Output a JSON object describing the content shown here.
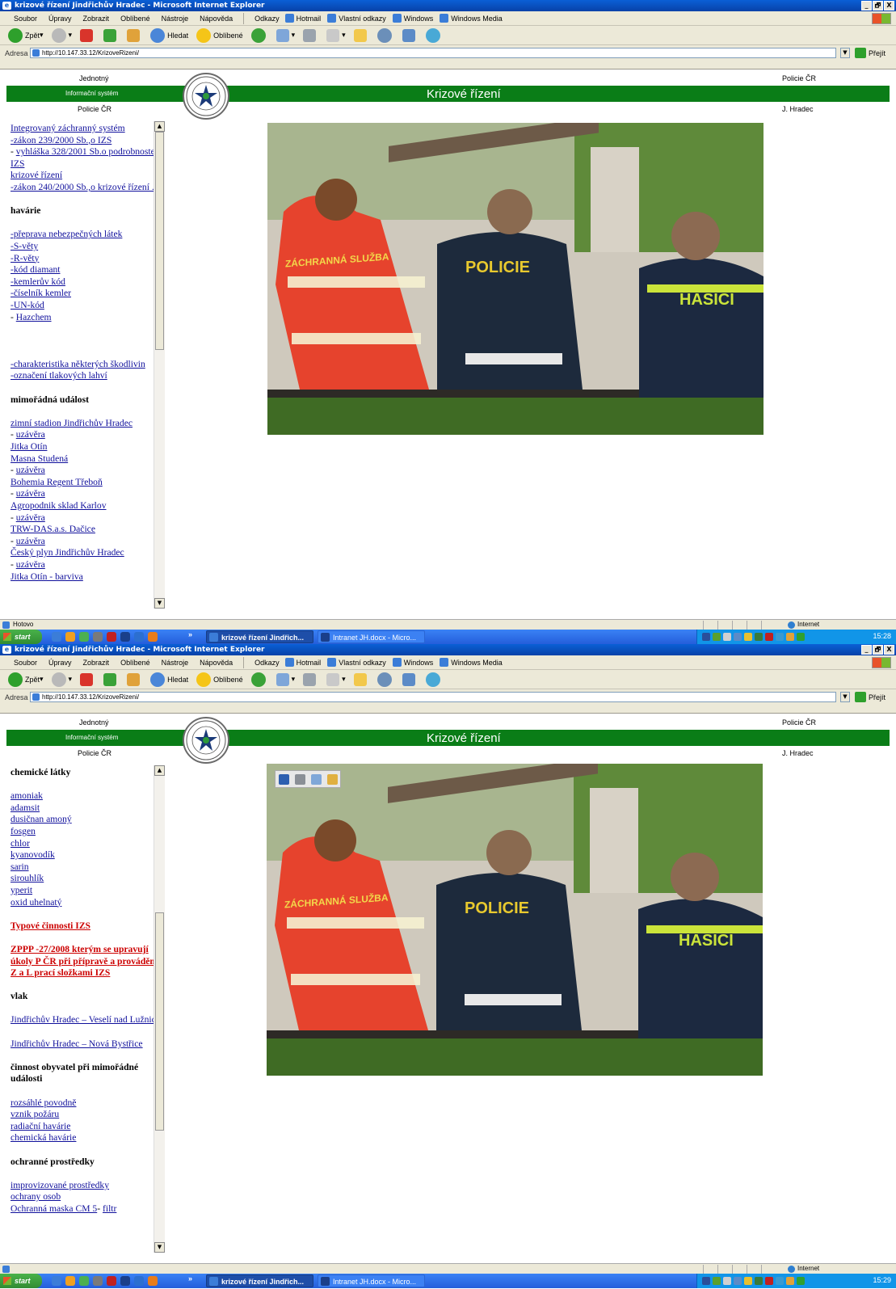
{
  "window": {
    "title": "krizové řízení Jindřichův Hradec - Microsoft Internet Explorer",
    "controls": [
      "_",
      "🗗",
      "X"
    ]
  },
  "menubar": {
    "items": [
      "Soubor",
      "Úpravy",
      "Zobrazit",
      "Oblíbené",
      "Nástroje",
      "Nápověda"
    ],
    "links_label": "Odkazy",
    "links": [
      "Hotmail",
      "Vlastní odkazy",
      "Windows",
      "Windows Media"
    ]
  },
  "toolbar": {
    "back": "Zpět",
    "search": "Hledat",
    "favorites": "Oblíbené"
  },
  "address": {
    "label": "Adresa",
    "url": "http://10.147.33.12/KrizoveRizeni/",
    "go": "Přejít"
  },
  "header": {
    "top_left": "Jednotný",
    "top_right": "Policie ČR",
    "bar_left": "Informační systém",
    "title": "Krizové řízení",
    "bottom_left": "Policie ČR",
    "bottom_right": "J. Hradec"
  },
  "emblem_text": "POLICIE ČESKÉ REPUBLIKY",
  "photo_labels": {
    "jacket_red": "ZÁCHRANNÁ SLUŽBA",
    "jacket_police": "POLICIE",
    "jacket_fire": "HASIČI"
  },
  "nav1": {
    "links_a": [
      "Integrovaný záchranný systém",
      "-zákon 239/2000 Sb.,o IZS"
    ],
    "vyhlaska_prefix": "- ",
    "vyhlaska": "vyhláška 328/2001 Sb.o podrobnostech IZS",
    "links_b": [
      "krizové řízení",
      "-zákon 240/2000 Sb.,o krizové řízení ."
    ],
    "heading_havarie": "havárie",
    "links_c": [
      "-přeprava nebezpečných látek",
      "-S-věty",
      "-R-věty",
      "-kód diamant",
      "-kemlerův kód",
      "-číselník kemler",
      "-UN-kód"
    ],
    "hazchem_prefix": "- ",
    "hazchem": "Hazchem",
    "links_d": [
      "-charakteristika některých škodlivin",
      "-označení tlakových lahví"
    ],
    "heading_mimoradna": "mimořádná událost",
    "entries": [
      "zimní stadion Jindřichův Hradec",
      "uzávěra",
      "Jitka Otín",
      "Masna Studená",
      "uzávěra",
      "Bohemia Regent Třeboň",
      "uzávěra",
      "Agropodnik sklad Karlov",
      "uzávěra",
      "TRW-DAS.a.s. Dačice",
      "uzávěra",
      "Český plyn Jindřichův Hradec",
      "uzávěra",
      "Jitka Otín - barviva"
    ]
  },
  "nav2": {
    "heading_chem": "chemické látky",
    "chem": [
      "amoniak",
      "adamsit",
      "dusičnan amoný",
      "fosgen",
      "chlor",
      "kyanovodík",
      "sarin",
      "sirouhlík",
      "yperit",
      "oxid uhelnatý"
    ],
    "typove": "Typové činnosti IZS",
    "zppp": "ZPPP -27/2008 kterým se upravují úkoly P ČR při přípravě a provádění Z a L prací složkami IZS",
    "heading_vlak": "vlak",
    "vlak": [
      "Jindřichův Hradec – Veselí nad Lužnicí",
      "Jindřichův Hradec – Nová Bystřice"
    ],
    "heading_cinnost": "činnost obyvatel při mimořádné události",
    "cinnost": [
      "rozsáhlé povodně",
      "vznik požáru",
      "radiační havárie",
      "chemická havárie"
    ],
    "heading_ochranne": "ochranné prostředky",
    "ochranne": [
      "improvizované prostředky",
      "ochrany osob"
    ],
    "maska": "Ochranná maska CM 5",
    "maska_sep": "- ",
    "filtr": "filtr"
  },
  "status": {
    "text1": "Hotovo",
    "text2": "",
    "zone": "Internet"
  },
  "taskbar": {
    "start": "start",
    "chevron": "»",
    "task1": "krizové řízení Jindřich...",
    "task2": "Intranet JH.docx - Micro...",
    "clock1": "15:28",
    "clock2": "15:29"
  },
  "colors": {
    "green_bar": "#0a7d17",
    "link": "#10109c",
    "red_link": "#cc0000",
    "xp_blue": "#245edb"
  },
  "scroll": {
    "shot1_position": 0.0,
    "shot2_position": 0.55
  }
}
